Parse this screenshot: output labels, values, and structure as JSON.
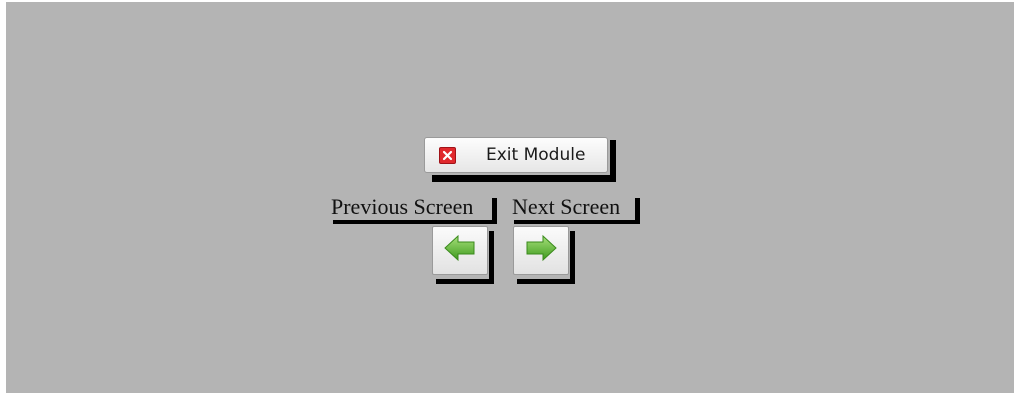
{
  "exit_button": {
    "label": "Exit Module",
    "icon": "close-icon"
  },
  "navigation": {
    "previous_label": "Previous Screen",
    "next_label": "Next Screen",
    "previous_icon": "arrow-left-icon",
    "next_icon": "arrow-right-icon"
  },
  "colors": {
    "background": "#b4b4b4",
    "close_icon": "#e0282c",
    "arrow_green": "#5cb82e"
  }
}
